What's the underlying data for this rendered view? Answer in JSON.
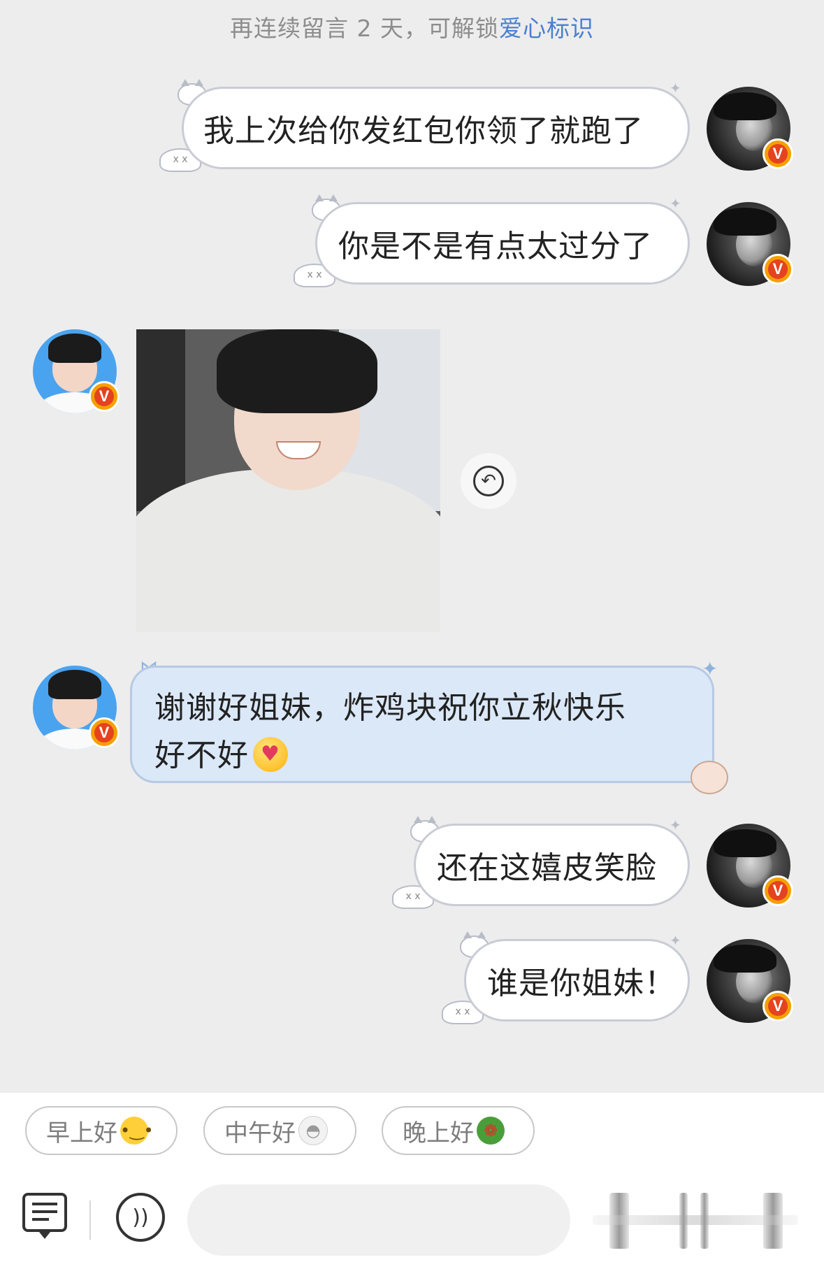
{
  "notice": {
    "prefix": "再连续留言 2 天，可解锁",
    "link": "爱心标识"
  },
  "messages": [
    {
      "id": "m1",
      "side": "right",
      "type": "text",
      "text": "我上次给你发红包你领了就跑了"
    },
    {
      "id": "m2",
      "side": "right",
      "type": "text",
      "text": "你是不是有点太过分了"
    },
    {
      "id": "m3",
      "side": "left",
      "type": "image"
    },
    {
      "id": "m4",
      "side": "left",
      "type": "text",
      "line1": "谢谢好姐妹，炸鸡块祝你立秋快乐",
      "line2": "好不好"
    },
    {
      "id": "m5",
      "side": "right",
      "type": "text",
      "text": "还在这嬉皮笑脸"
    },
    {
      "id": "m6",
      "side": "right",
      "type": "text",
      "text": "谁是你姐妹！"
    }
  ],
  "badge": {
    "letter": "V",
    "color": "#f5a000"
  },
  "quick_replies": [
    {
      "label": "早上好",
      "icon": "neutral-face-emoji"
    },
    {
      "label": "中午好",
      "icon": "rice-bowl-emoji"
    },
    {
      "label": "晚上好",
      "icon": "salad-emoji"
    }
  ],
  "input": {
    "value": "",
    "placeholder": ""
  },
  "icons": {
    "reply": "undo-arrow-icon",
    "message": "message-list-icon",
    "voice": "voice-icon"
  },
  "colors": {
    "background": "#ededed",
    "link": "#4a7fd0",
    "bubble_border": "#c9ccd4",
    "blue_bubble": "#dbe8f8"
  }
}
